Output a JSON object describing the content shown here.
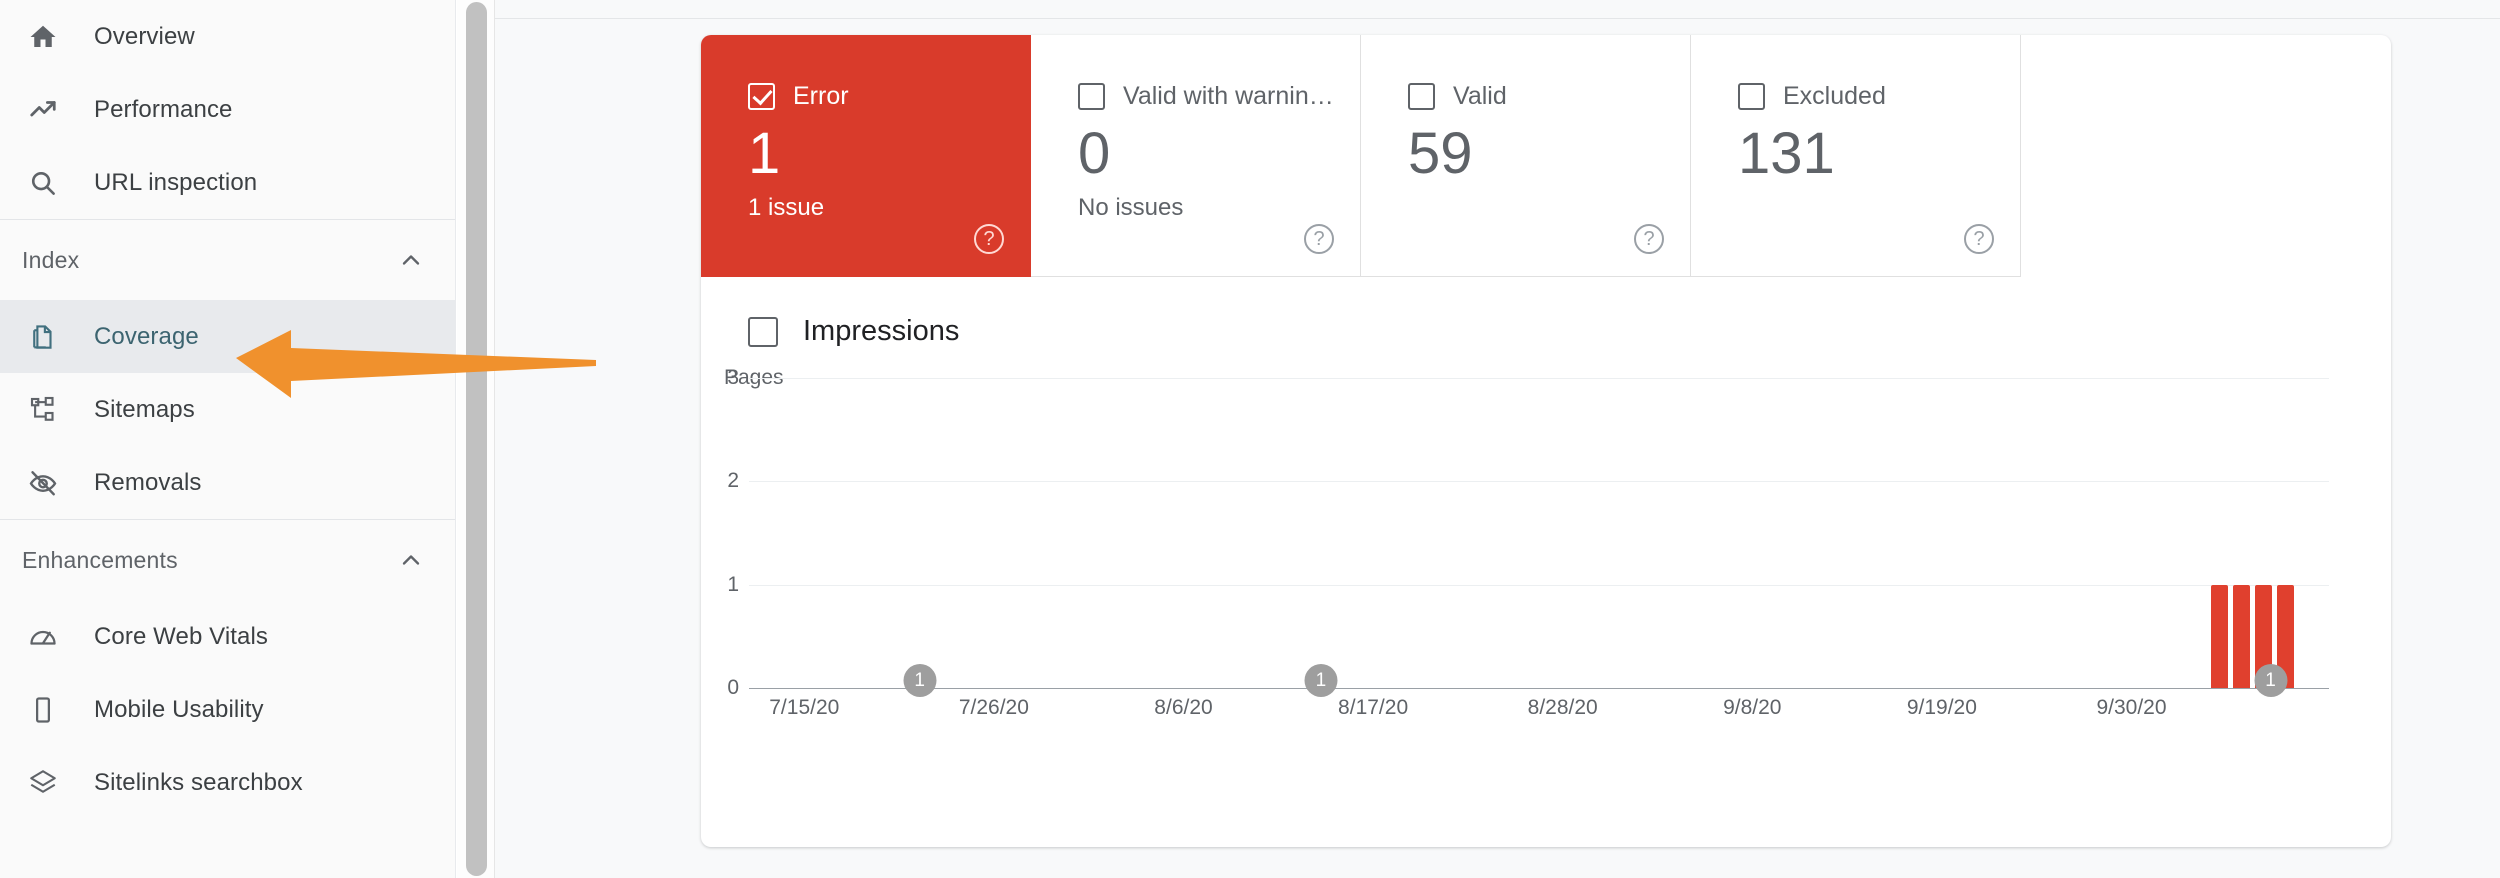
{
  "sidebar": {
    "primary_items": [
      {
        "label": "Overview",
        "icon": "home-icon",
        "id": "overview"
      },
      {
        "label": "Performance",
        "icon": "trending-up-icon",
        "id": "performance"
      },
      {
        "label": "URL inspection",
        "icon": "search-icon",
        "id": "url-inspection"
      }
    ],
    "sections": [
      {
        "title": "Index",
        "collapse_icon": "chevron-up-icon",
        "items": [
          {
            "label": "Coverage",
            "icon": "pages-copy-icon",
            "id": "coverage",
            "selected": true
          },
          {
            "label": "Sitemaps",
            "icon": "sitemap-icon",
            "id": "sitemaps",
            "selected": false
          },
          {
            "label": "Removals",
            "icon": "eye-off-icon",
            "id": "removals",
            "selected": false
          }
        ]
      },
      {
        "title": "Enhancements",
        "collapse_icon": "chevron-up-icon",
        "items": [
          {
            "label": "Core Web Vitals",
            "icon": "speedometer-icon",
            "id": "core-web-vitals",
            "selected": false
          },
          {
            "label": "Mobile Usability",
            "icon": "mobile-phone-icon",
            "id": "mobile-usability",
            "selected": false
          },
          {
            "label": "Sitelinks searchbox",
            "icon": "layers-icon",
            "id": "sitelinks-searchbox",
            "selected": false
          }
        ]
      }
    ]
  },
  "status_cards": [
    {
      "label": "Error",
      "value": "1",
      "sub": "1 issue",
      "checked": true,
      "state": "error",
      "help": "?"
    },
    {
      "label": "Valid with warnin…",
      "value": "0",
      "sub": "No issues",
      "checked": false,
      "state": "warning",
      "help": "?"
    },
    {
      "label": "Valid",
      "value": "59",
      "sub": "",
      "checked": false,
      "state": "valid",
      "help": "?"
    },
    {
      "label": "Excluded",
      "value": "131",
      "sub": "",
      "checked": false,
      "state": "excluded",
      "help": "?"
    }
  ],
  "legend": {
    "impressions_label": "Impressions",
    "impressions_checked": false
  },
  "colors": {
    "error_red": "#d93b2b",
    "bar_red": "#e0402e",
    "annotation_orange": "#f0912d",
    "selected_nav_bg": "#e8eaed",
    "selected_nav_text": "#3c6470",
    "muted_text": "#5f6368"
  },
  "chart_data": {
    "type": "bar",
    "title": "",
    "ylabel": "Pages",
    "xlabel": "",
    "ylim": [
      0,
      3
    ],
    "yticks": [
      "0",
      "1",
      "2",
      "3"
    ],
    "grid": true,
    "legend_position": "top-left",
    "xtick_labels": [
      "7/15/20",
      "7/26/20",
      "8/6/20",
      "8/17/20",
      "8/28/20",
      "9/8/20",
      "9/19/20",
      "9/30/20"
    ],
    "xtick_fractions": [
      0.035,
      0.155,
      0.275,
      0.395,
      0.515,
      0.635,
      0.755,
      0.875
    ],
    "series": [
      {
        "name": "Error",
        "color": "#e0402e",
        "bars": [
          {
            "x_fraction": 0.925,
            "value": 1
          },
          {
            "x_fraction": 0.939,
            "value": 1
          },
          {
            "x_fraction": 0.953,
            "value": 1
          },
          {
            "x_fraction": 0.967,
            "value": 1
          }
        ]
      }
    ],
    "annotations": [
      {
        "label": "1",
        "x_fraction": 0.108
      },
      {
        "label": "1",
        "x_fraction": 0.362
      },
      {
        "label": "1",
        "x_fraction": 0.963
      }
    ]
  },
  "overlay": {
    "arrow": {
      "icon": "left-pointing-arrow-annotation",
      "color": "#f0912d",
      "points_to": "Coverage"
    }
  }
}
